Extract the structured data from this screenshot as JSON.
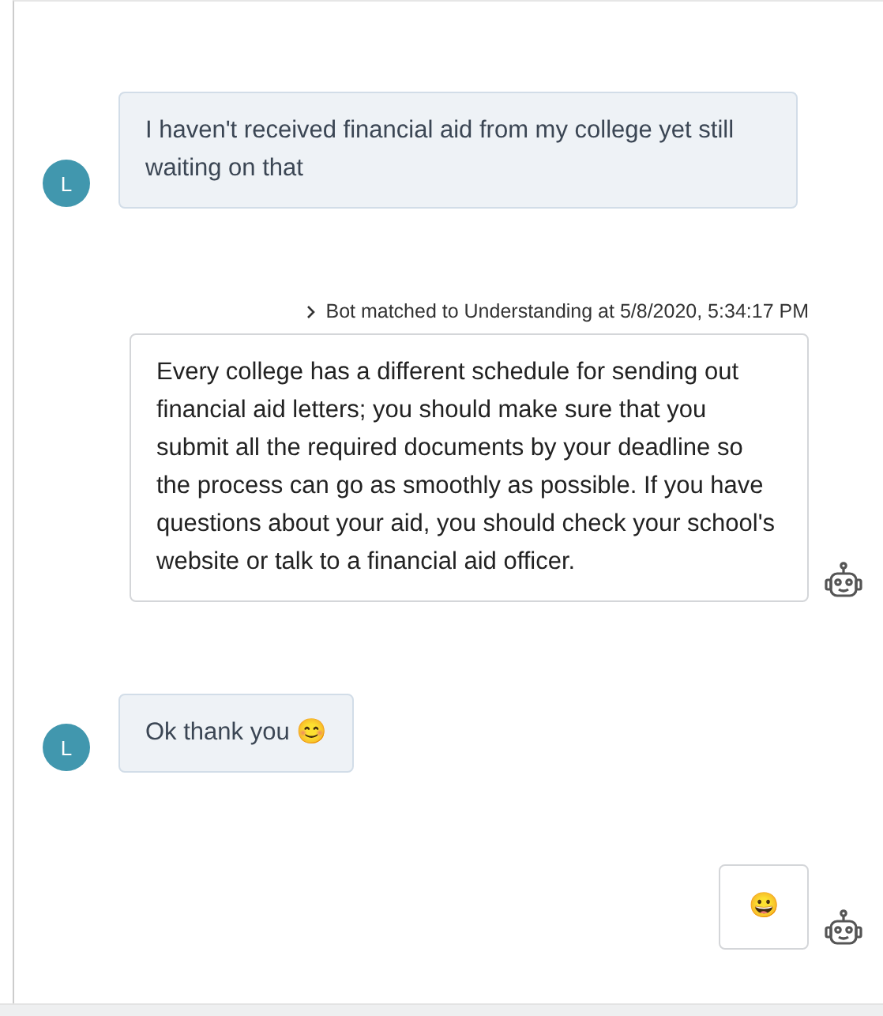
{
  "messages": [
    {
      "kind": "user",
      "avatar": "L",
      "text": "I haven't received financial aid from my college yet still waiting on that"
    },
    {
      "kind": "bot",
      "meta": "Bot matched to Understanding at 5/8/2020, 5:34:17 PM",
      "text": "Every college has a different schedule for sending out financial aid letters; you should make sure that you submit all the required documents by your deadline so the process can go as smoothly as possible. If you have questions about your aid, you should check your school's website or talk to a financial aid officer."
    },
    {
      "kind": "user",
      "avatar": "L",
      "text": "Ok thank you 😊"
    },
    {
      "kind": "bot",
      "text": "😀"
    }
  ]
}
